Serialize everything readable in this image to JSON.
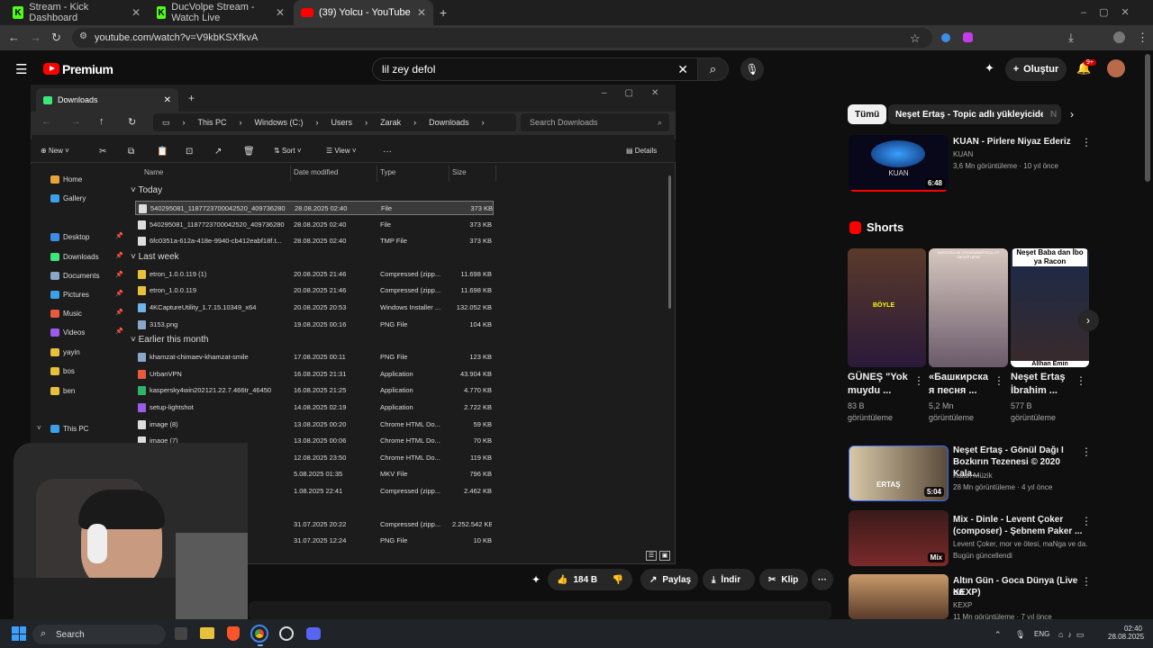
{
  "browser": {
    "tabs": [
      {
        "label": "Stream - Kick Dashboard",
        "close": "✕"
      },
      {
        "label": "DucVolpe Stream - Watch Live",
        "close": "✕"
      },
      {
        "label": "(39) Yolcu - YouTube",
        "close": "✕"
      }
    ],
    "new_tab": "+",
    "url": "youtube.com/watch?v=V9kbKSXfkvA"
  },
  "youtube": {
    "logo": "Premium",
    "search_query": "lil zey defol",
    "create_label": "Oluştur",
    "notif_count": "9+",
    "chips": [
      "Tümü",
      "Neşet Ertaş - Topic adlı yükleyiciden",
      "N"
    ],
    "actions": {
      "likes": "184 B",
      "share": "Paylaş",
      "download": "İndir",
      "clip": "Klip"
    },
    "shorts_heading": "Shorts",
    "shorts": [
      {
        "title_1": "GÜNEŞ \"Yok",
        "title_2": "muydu ...",
        "views_1": "83 B",
        "views_2": "görüntüleme",
        "overlay": "BÖYLE"
      },
      {
        "title_1": "«Башкирска",
        "title_2": "я песня ...",
        "views_1": "5,2 Mn",
        "views_2": "görüntüleme",
        "overlay": "КИНОСЕА НЕ ОТКАЗЫВАЙТЕСЬ ОТ СВОЕЙ ЦЕЛИ"
      },
      {
        "title_1": "Neşet Ertaş",
        "title_2": "İbrahim ...",
        "views_1": "577 B",
        "views_2": "görüntüleme",
        "overlay": "Neşet Baba dan İbo ya Racon",
        "caption": "Allhan Emin"
      }
    ],
    "videos": [
      {
        "title_1": "KUAN - Pirlere Niyaz Ederiz",
        "title_2": "",
        "channel": "KUAN",
        "meta": "3,6 Mn görüntüleme · 10 yıl önce",
        "duration": "6:48",
        "thumb_label": "KUAN"
      },
      {
        "title_1": "Neşet Ertaş - Gönül Dağı I",
        "title_2": "Bozkırın Tezenesi © 2020 Kala...",
        "channel": "Kalan Müzik",
        "meta": "28 Mn görüntüleme · 4 yıl önce",
        "duration": "5:04",
        "thumb_label": "ERTAŞ"
      },
      {
        "title_1": "Mix - Dinle - Levent Çoker",
        "title_2": "(composer) - Şebnem Paker ...",
        "channel": "Levent Çoker, mor ve ötesi, maNga ve da...",
        "meta": "Bugün güncellendi",
        "duration": "Mix",
        "thumb_label": ""
      },
      {
        "title_1": "Altın Gün - Goca Dünya (Live on",
        "title_2": "KEXP)",
        "channel": "KEXP",
        "meta": "11 Mn görüntüleme · 7 yıl önce",
        "duration": "",
        "thumb_label": ""
      }
    ]
  },
  "explorer": {
    "tab_title": "Downloads",
    "breadcrumb": [
      "This PC",
      "Windows (C:)",
      "Users",
      "Zarak",
      "Downloads"
    ],
    "search_placeholder": "Search Downloads",
    "toolbar": {
      "new": "New",
      "sort": "Sort",
      "view": "View",
      "more": "···",
      "details": "Details"
    },
    "sidebar": [
      {
        "label": "Home",
        "color": "#e8a33c"
      },
      {
        "label": "Gallery",
        "color": "#3ca0e8"
      },
      {
        "label": "Desktop",
        "color": "#3c8de8",
        "pinned": true
      },
      {
        "label": "Downloads",
        "color": "#3ce87a",
        "pinned": true
      },
      {
        "label": "Documents",
        "color": "#8aa6c8",
        "pinned": true
      },
      {
        "label": "Pictures",
        "color": "#3ca0e8",
        "pinned": true
      },
      {
        "label": "Music",
        "color": "#e85a3c",
        "pinned": true
      },
      {
        "label": "Videos",
        "color": "#9b5ce8",
        "pinned": true
      },
      {
        "label": "yayin",
        "color": "#e8c13c"
      },
      {
        "label": "bos",
        "color": "#e8c13c"
      },
      {
        "label": "ben",
        "color": "#e8c13c"
      },
      {
        "label": "This PC",
        "color": "#3ca0e8"
      }
    ],
    "columns": [
      "Name",
      "Date modified",
      "Type",
      "Size"
    ],
    "groups": [
      {
        "label": "Today",
        "rows": [
          {
            "name": "540295081_1187723700042520_409736280...",
            "date": "28.08.2025 02:40",
            "type": "File",
            "size": "373 KB",
            "icon": "#dddddd"
          },
          {
            "name": "540295081_1187723700042520_409736280...",
            "date": "28.08.2025 02:40",
            "type": "File",
            "size": "373 KB",
            "icon": "#dddddd"
          },
          {
            "name": "6fc0351a-612a-418e-9940-cb412eabf18f.t...",
            "date": "28.08.2025 02:40",
            "type": "TMP File",
            "size": "373 KB",
            "icon": "#dddddd"
          }
        ]
      },
      {
        "label": "Last week",
        "rows": [
          {
            "name": "etron_1.0.0.119 (1)",
            "date": "20.08.2025 21:46",
            "type": "Compressed (zipp...",
            "size": "11.698 KB",
            "icon": "#e8c13c"
          },
          {
            "name": "etron_1.0.0.119",
            "date": "20.08.2025 21:46",
            "type": "Compressed (zipp...",
            "size": "11.698 KB",
            "icon": "#e8c13c"
          },
          {
            "name": "4KCaptureUtility_1.7.15.10349_x64",
            "date": "20.08.2025 20:53",
            "type": "Windows Installer ...",
            "size": "132.052 KB",
            "icon": "#6fb3e8"
          },
          {
            "name": "3153.png",
            "date": "19.08.2025 00:16",
            "type": "PNG File",
            "size": "104 KB",
            "icon": "#8aa6c8"
          }
        ]
      },
      {
        "label": "Earlier this month",
        "rows": [
          {
            "name": "khamzat-chimaev-khamzat-smile",
            "date": "17.08.2025 00:11",
            "type": "PNG File",
            "size": "123 KB",
            "icon": "#8aa6c8"
          },
          {
            "name": "UrbanVPN",
            "date": "16.08.2025 21:31",
            "type": "Application",
            "size": "43.904 KB",
            "icon": "#e85a3c"
          },
          {
            "name": "kaspersky4win202121.22.7.466tr_46450",
            "date": "16.08.2025 21:25",
            "type": "Application",
            "size": "4.770 KB",
            "icon": "#2fb36a"
          },
          {
            "name": "setup-lightshot",
            "date": "14.08.2025 02:19",
            "type": "Application",
            "size": "2.722 KB",
            "icon": "#9b5ce8"
          },
          {
            "name": "image (8)",
            "date": "13.08.2025 00:20",
            "type": "Chrome HTML Do...",
            "size": "59 KB",
            "icon": "#dddddd"
          },
          {
            "name": "image (7)",
            "date": "13.08.2025 00:06",
            "type": "Chrome HTML Do...",
            "size": "70 KB",
            "icon": "#dddddd"
          },
          {
            "name": "",
            "date": "12.08.2025 23:50",
            "type": "Chrome HTML Do...",
            "size": "119 KB",
            "icon": "#dddddd"
          },
          {
            "name": "",
            "date": "5.08.2025 01:35",
            "type": "MKV File",
            "size": "796 KB",
            "icon": "#dddddd"
          },
          {
            "name": "_NoCD_W...",
            "date": "1.08.2025 22:41",
            "type": "Compressed (zipp...",
            "size": "2.462 KB",
            "icon": "#e8c13c"
          }
        ]
      },
      {
        "label": "",
        "rows": [
          {
            "name": "",
            "date": "31.07.2025 20:22",
            "type": "Compressed (zipp...",
            "size": "2.252.542 KB",
            "icon": "#e8c13c"
          },
          {
            "name": "",
            "date": "31.07.2025 12:24",
            "type": "PNG File",
            "size": "10 KB",
            "icon": "#8aa6c8"
          }
        ]
      }
    ]
  },
  "taskbar": {
    "search": "Search",
    "lang": "ENG",
    "time": "02:40",
    "date": "28.08.2025"
  },
  "colors": {
    "yt_red": "#ff0000",
    "kick_green": "#53fc18",
    "selection": "#3a3a3a"
  }
}
